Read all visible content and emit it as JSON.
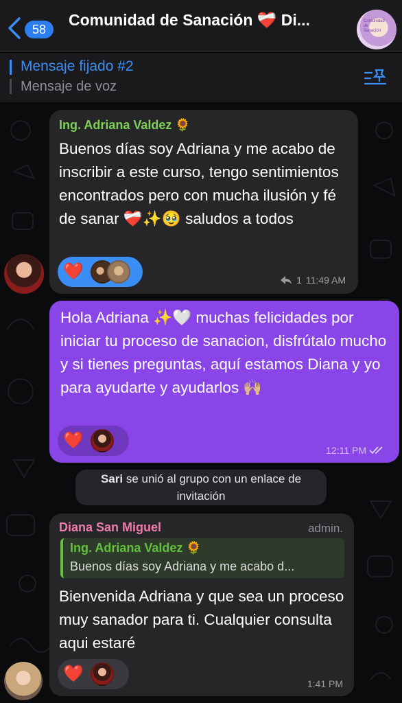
{
  "header": {
    "back_count": "58",
    "title": "Comunidad de Sanación ❤️‍🩹 Di...",
    "avatar_text": "Comunidad de Sanación"
  },
  "pinned": {
    "title": "Mensaje fijado #2",
    "subtitle": "Mensaje de voz"
  },
  "messages": [
    {
      "sender": "Ing. Adriana Valdez 🌻",
      "text": "Buenos días soy Adriana y me acabo de inscribir a este curso, tengo sentimientos encontrados pero con mucha ilusión y fé de sanar ❤️‍🩹✨🥹 saludos a todos",
      "reply_count": "1",
      "time": "11:49 AM",
      "reaction": "❤️"
    },
    {
      "text": "Hola Adriana ✨🤍 muchas felicidades por iniciar tu proceso de sanacion, disfrútalo mucho y si tienes preguntas, aquí estamos Diana y yo para ayudarte y ayudarlos 🙌🏼",
      "time": "12:11 PM",
      "reaction": "❤️"
    },
    {
      "service_name": "Sari",
      "service_text": " se unió al grupo con un enlace de invitación"
    },
    {
      "sender": "Diana San Miguel",
      "role": "admin.",
      "reply_name": "Ing. Adriana Valdez 🌻",
      "reply_text": "Buenos días soy Adriana y me acabo d...",
      "text": "Bienvenida Adriana y que sea un proceso muy sanador para ti. Cualquier consulta aqui estaré",
      "time": "1:41 PM",
      "reaction": "❤️"
    }
  ],
  "colors": {
    "accent_blue": "#3a8ef6",
    "outgoing_bubble": "#8945e8",
    "incoming_bubble": "#262628",
    "sender_green": "#7ed05a",
    "sender_pink": "#f07aa8"
  }
}
